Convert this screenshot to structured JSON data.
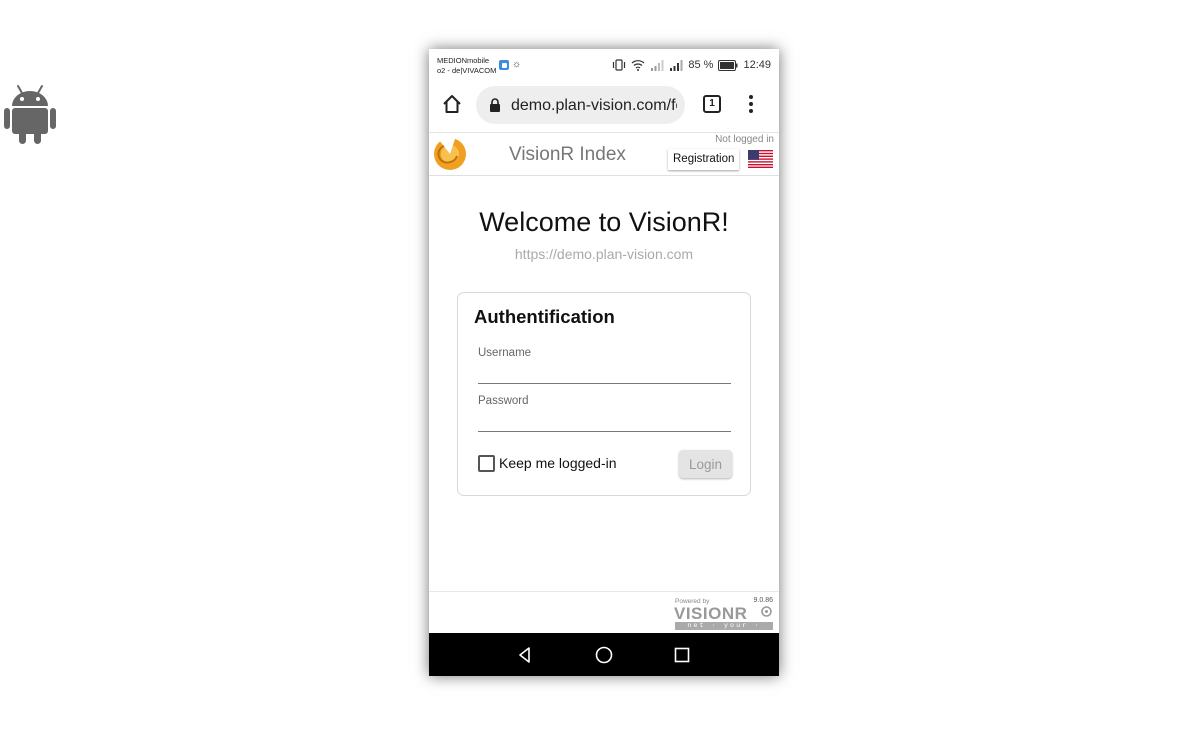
{
  "status_bar": {
    "carrier_line1": "MEDIONmobile",
    "carrier_line2": "o2 - de|VIVACOM",
    "battery": "85 %",
    "time": "12:49",
    "icons": [
      "messenger-icon",
      "brightness-icon",
      "vibrate-icon",
      "wifi-icon",
      "signal-icon",
      "signal-icon",
      "battery-icon"
    ]
  },
  "browser": {
    "url": "demo.plan-vision.com/fc",
    "tab_count": "1",
    "icons": [
      "home-icon",
      "lock-icon",
      "tabs-icon",
      "more-vert-icon"
    ]
  },
  "app_header": {
    "title": "VisionR Index",
    "login_status": "Not logged in",
    "registration_label": "Registration",
    "language_icon": "us-flag-icon"
  },
  "main": {
    "welcome": "Welcome to VisionR!",
    "site_url": "https://demo.plan-vision.com"
  },
  "auth": {
    "title": "Authentification",
    "username_label": "Username",
    "username_value": "",
    "password_label": "Password",
    "password_value": "",
    "keep_logged_label": "Keep me logged-in",
    "keep_logged_checked": false,
    "login_label": "Login"
  },
  "footer": {
    "powered_by": "Powered by",
    "brand": "VISIONR",
    "tagline": "net · your · data",
    "version": "9.0.86"
  },
  "nav_bar": {
    "icons": [
      "back-icon",
      "home-circle-icon",
      "recents-icon"
    ]
  },
  "colors": {
    "accent_orange": "#f0a020",
    "text_dark": "#111111",
    "muted": "#aaaaaa",
    "android_green_gray": "#666666"
  }
}
